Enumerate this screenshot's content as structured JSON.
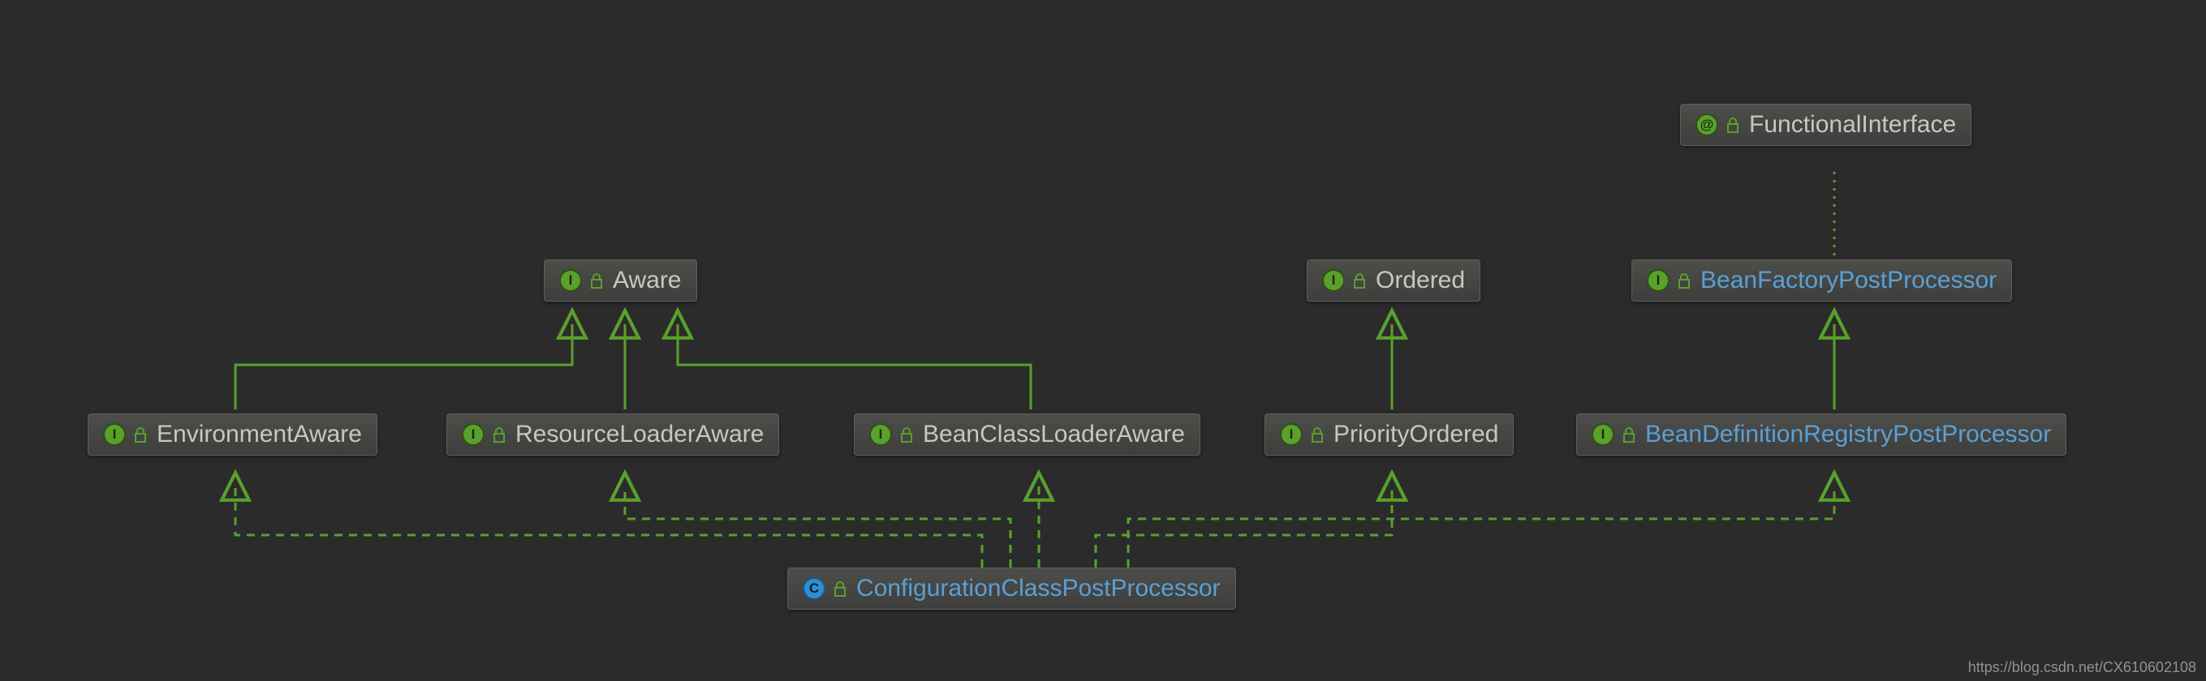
{
  "nodes": {
    "functionalInterface": {
      "label": "FunctionalInterface",
      "type": "annotation",
      "color": "gray"
    },
    "aware": {
      "label": "Aware",
      "type": "interface",
      "color": "gray"
    },
    "ordered": {
      "label": "Ordered",
      "type": "interface",
      "color": "gray"
    },
    "beanFactoryPP": {
      "label": "BeanFactoryPostProcessor",
      "type": "interface",
      "color": "blue"
    },
    "environmentAware": {
      "label": "EnvironmentAware",
      "type": "interface",
      "color": "gray"
    },
    "resourceLoaderAware": {
      "label": "ResourceLoaderAware",
      "type": "interface",
      "color": "gray"
    },
    "beanClassLoaderAware": {
      "label": "BeanClassLoaderAware",
      "type": "interface",
      "color": "gray"
    },
    "priorityOrdered": {
      "label": "PriorityOrdered",
      "type": "interface",
      "color": "gray"
    },
    "beanDefRegPP": {
      "label": "BeanDefinitionRegistryPostProcessor",
      "type": "interface",
      "color": "blue"
    },
    "configClassPP": {
      "label": "ConfigurationClassPostProcessor",
      "type": "class",
      "color": "blue"
    }
  },
  "watermark": "https://blog.csdn.net/CX610602108",
  "edges_description": [
    {
      "from": "environmentAware",
      "to": "aware",
      "style": "solid"
    },
    {
      "from": "resourceLoaderAware",
      "to": "aware",
      "style": "solid"
    },
    {
      "from": "beanClassLoaderAware",
      "to": "aware",
      "style": "solid"
    },
    {
      "from": "priorityOrdered",
      "to": "ordered",
      "style": "solid"
    },
    {
      "from": "beanDefRegPP",
      "to": "beanFactoryPP",
      "style": "solid"
    },
    {
      "from": "beanFactoryPP",
      "to": "functionalInterface",
      "style": "dotted"
    },
    {
      "from": "configClassPP",
      "to": "environmentAware",
      "style": "dashed"
    },
    {
      "from": "configClassPP",
      "to": "resourceLoaderAware",
      "style": "dashed"
    },
    {
      "from": "configClassPP",
      "to": "beanClassLoaderAware",
      "style": "dashed"
    },
    {
      "from": "configClassPP",
      "to": "priorityOrdered",
      "style": "dashed"
    },
    {
      "from": "configClassPP",
      "to": "beanDefRegPP",
      "style": "dashed"
    }
  ]
}
